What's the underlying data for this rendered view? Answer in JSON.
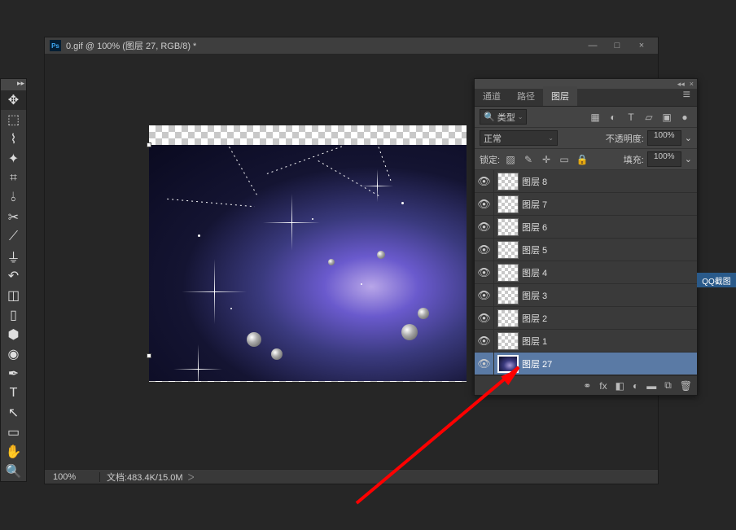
{
  "doc_window": {
    "ps_icon": "Ps",
    "title": "0.gif @ 100% (图层 27, RGB/8) *",
    "win_min": "—",
    "win_max": "□",
    "win_close": "×"
  },
  "status": {
    "zoom": "100%",
    "doc_size": "文档:483.4K/15.0M"
  },
  "tools_header": "▸▸",
  "panel": {
    "collapse": "◂◂",
    "close": "×",
    "tabs": {
      "channels": "通道",
      "paths": "路径",
      "layers": "图层"
    },
    "menu_icon": "≡",
    "filter": {
      "search_icon": "🔍",
      "kind": "类型",
      "icons": {
        "image": "▦",
        "adjust": "◐",
        "type": "T",
        "shape": "▱",
        "smart": "▣",
        "dot": "●"
      }
    },
    "blend": {
      "mode": "正常",
      "opacity_label": "不透明度:",
      "opacity_value": "100%"
    },
    "lock": {
      "label": "锁定:",
      "icons": {
        "trans": "▨",
        "paint": "✎",
        "pos": "✛",
        "art": "▭",
        "all": "🔒"
      },
      "fill_label": "填充:",
      "fill_value": "100%"
    },
    "layers": [
      {
        "name": "图层 8",
        "selected": false,
        "thumb": "checker"
      },
      {
        "name": "图层 7",
        "selected": false,
        "thumb": "checker"
      },
      {
        "name": "图层 6",
        "selected": false,
        "thumb": "checker"
      },
      {
        "name": "图层 5",
        "selected": false,
        "thumb": "checker"
      },
      {
        "name": "图层 4",
        "selected": false,
        "thumb": "checker"
      },
      {
        "name": "图层 3",
        "selected": false,
        "thumb": "checker"
      },
      {
        "name": "图层 2",
        "selected": false,
        "thumb": "checker"
      },
      {
        "name": "图层 1",
        "selected": false,
        "thumb": "checker"
      },
      {
        "name": "图层 27",
        "selected": true,
        "thumb": "img"
      }
    ],
    "footer": {
      "link": "⚭",
      "fx": "fx",
      "mask": "◧",
      "adjust": "◐",
      "group": "▬",
      "new": "⧉",
      "trash": "🗑"
    }
  },
  "side_tag": "QQ截图"
}
